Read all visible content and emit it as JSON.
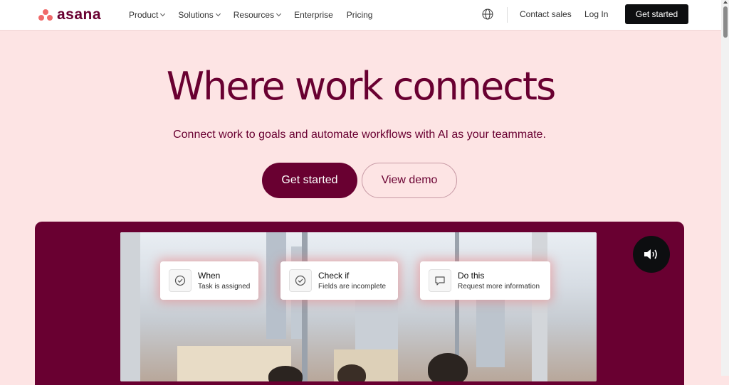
{
  "nav": {
    "logo_text": "asana",
    "links": [
      {
        "label": "Product",
        "dropdown": true
      },
      {
        "label": "Solutions",
        "dropdown": true
      },
      {
        "label": "Resources",
        "dropdown": true
      },
      {
        "label": "Enterprise",
        "dropdown": false
      },
      {
        "label": "Pricing",
        "dropdown": false
      }
    ],
    "contact_label": "Contact sales",
    "login_label": "Log In",
    "cta_label": "Get started",
    "globe_icon": "globe-icon"
  },
  "hero": {
    "title": "Where work connects",
    "subtitle": "Connect work to goals and automate workflows with AI as your teammate.",
    "primary_button": "Get started",
    "secondary_button": "View demo"
  },
  "video": {
    "sound_icon": "volume-icon",
    "cards": [
      {
        "title": "When",
        "desc": "Task is assigned",
        "icon": "check-circle-icon"
      },
      {
        "title": "Check if",
        "desc": "Fields are incomplete",
        "icon": "check-circle-icon"
      },
      {
        "title": "Do this",
        "desc": "Request more information",
        "icon": "comment-icon"
      }
    ]
  },
  "colors": {
    "brand": "#690031",
    "background": "#fde4e4",
    "logo": "#f06a6a",
    "nav_cta": "#0d0e10"
  }
}
